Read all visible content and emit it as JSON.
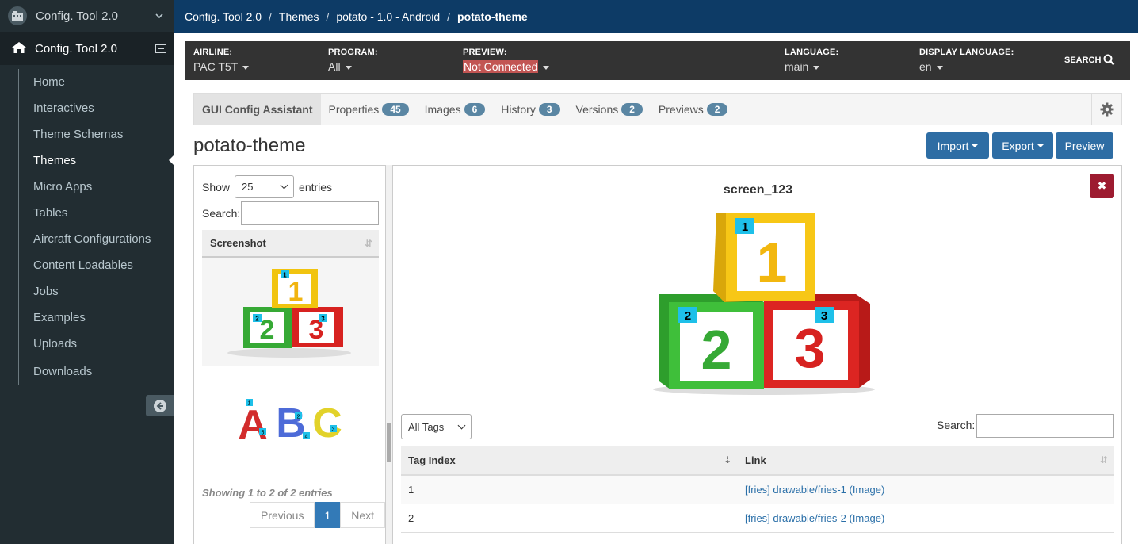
{
  "sidebar": {
    "app_title": "Config. Tool 2.0",
    "section_title": "Config. Tool 2.0",
    "items": [
      {
        "label": "Home"
      },
      {
        "label": "Interactives"
      },
      {
        "label": "Theme Schemas"
      },
      {
        "label": "Themes"
      },
      {
        "label": "Micro Apps"
      },
      {
        "label": "Tables"
      },
      {
        "label": "Aircraft Configurations"
      },
      {
        "label": "Content Loadables"
      },
      {
        "label": "Jobs"
      },
      {
        "label": "Examples"
      },
      {
        "label": "Uploads"
      },
      {
        "label": "Downloads"
      }
    ],
    "active_item": "Themes"
  },
  "breadcrumb": [
    "Config. Tool 2.0",
    "Themes",
    "potato - 1.0 - Android",
    "potato-theme"
  ],
  "filters": {
    "airline": {
      "label": "AIRLINE:",
      "value": "PAC T5T"
    },
    "program": {
      "label": "PROGRAM:",
      "value": "All"
    },
    "preview": {
      "label": "PREVIEW:",
      "value": "Not Connected"
    },
    "language": {
      "label": "LANGUAGE:",
      "value": "main"
    },
    "display_language": {
      "label": "DISPLAY LANGUAGE:",
      "value": "en"
    },
    "search_label": "SEARCH"
  },
  "tabs": [
    {
      "label": "GUI Config Assistant"
    },
    {
      "label": "Properties",
      "count": "45"
    },
    {
      "label": "Images",
      "count": "6"
    },
    {
      "label": "History",
      "count": "3"
    },
    {
      "label": "Versions",
      "count": "2"
    },
    {
      "label": "Previews",
      "count": "2"
    }
  ],
  "page_title": "potato-theme",
  "buttons": {
    "import": "Import",
    "export": "Export",
    "preview": "Preview"
  },
  "left_panel": {
    "show_label": "Show",
    "entries_value": "25",
    "entries_label": "entries",
    "search_label": "Search:",
    "column": "Screenshot",
    "info": "Showing 1 to 2 of 2 entries",
    "pager": {
      "previous": "Previous",
      "current": "1",
      "next": "Next"
    }
  },
  "right_panel": {
    "screen_name": "screen_123",
    "close": "✖",
    "tags_filter": "All Tags",
    "search_label": "Search:",
    "columns": [
      "Tag Index",
      "Link"
    ],
    "rows": [
      {
        "index": "1",
        "link": "[fries] drawable/fries-1 (Image)"
      },
      {
        "index": "2",
        "link": "[fries] drawable/fries-2 (Image)"
      }
    ]
  },
  "thumb_labels": {
    "blocks": [
      "1",
      "2",
      "3"
    ],
    "letters": [
      "A",
      "B",
      "C"
    ],
    "markers_abc": [
      "1",
      "2",
      "3",
      "4",
      "5"
    ]
  }
}
